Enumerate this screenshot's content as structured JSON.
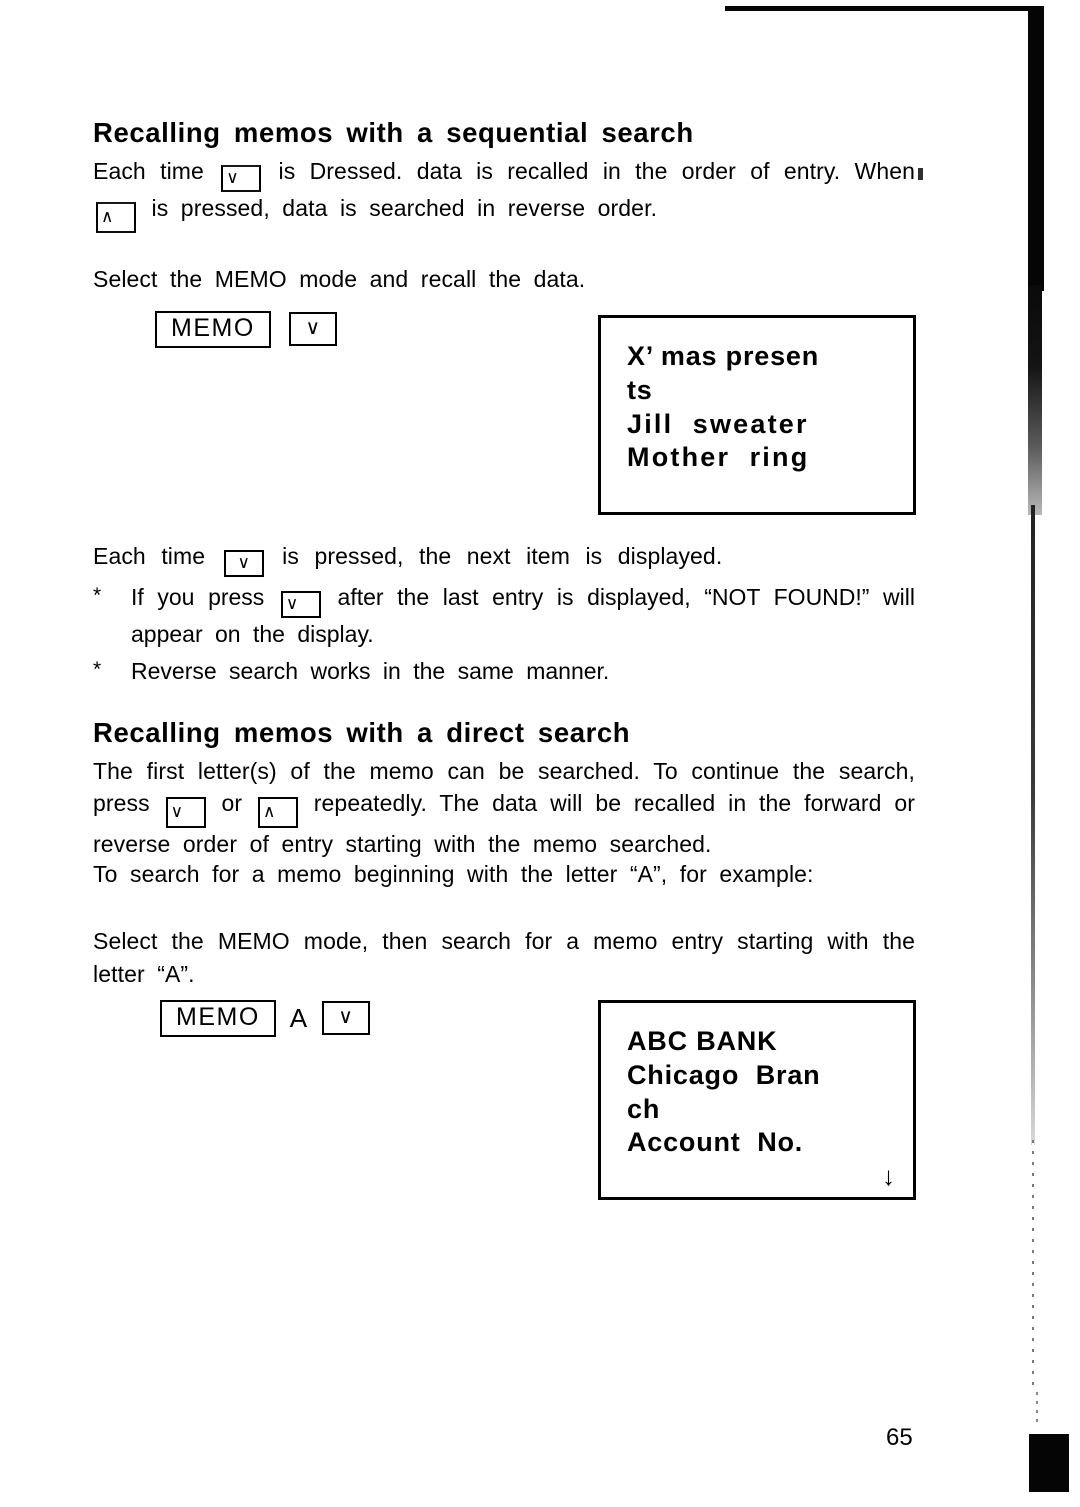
{
  "page": {
    "number": "65"
  },
  "sections": [
    {
      "heading": "Recalling memos with a sequential search",
      "intro": {
        "part1": "Each time",
        "key1": "∨",
        "part2": "is Dressed. data is recalled in the order of entry. When",
        "key2": "∧",
        "part3": "is pressed, data is searched in reverse order."
      },
      "instruction": "Select the MEMO mode and recall the data.",
      "keys": {
        "memo_label": "MEMO",
        "chevron_down": "∨"
      },
      "display": {
        "lines": [
          "X’ mas presen",
          "ts",
          "Jill  sweater",
          "Mother  ring"
        ],
        "arrow": ""
      },
      "after": {
        "line1_part1": "Each time",
        "line1_key": "∨",
        "line1_part2": "is pressed, the next item is displayed."
      },
      "notes": [
        {
          "mark": "*",
          "part1": "If you press",
          "key": "∨",
          "part2": "after the last entry is displayed, “NOT FOUND!” will appear on the display."
        },
        {
          "mark": "*",
          "part1": "Reverse search works in the same manner.",
          "key": "",
          "part2": ""
        }
      ]
    },
    {
      "heading": "Recalling memos with a direct search",
      "intro": {
        "part1": "The first letter(s) of the memo can be searched. To continue the search, press",
        "key1": "∨",
        "part2": "or",
        "key2": "∧",
        "part3": "repeatedly. The data will be recalled in the forward or reverse order of entry starting with the memo searched."
      },
      "example_line": "To search for a memo beginning with the letter “A”, for example:",
      "instruction": "Select the MEMO mode, then search for a memo entry starting with the letter “A”.",
      "keys": {
        "memo_label": "MEMO",
        "letter": "A",
        "chevron_down": "∨"
      },
      "display": {
        "lines": [
          "ABC BANK",
          "Chicago  Bran",
          "ch",
          "Account  No."
        ],
        "arrow": "↓"
      }
    }
  ],
  "colors": {
    "ink": "#000000",
    "paper": "#ffffff",
    "scan_edge": "#050505"
  }
}
